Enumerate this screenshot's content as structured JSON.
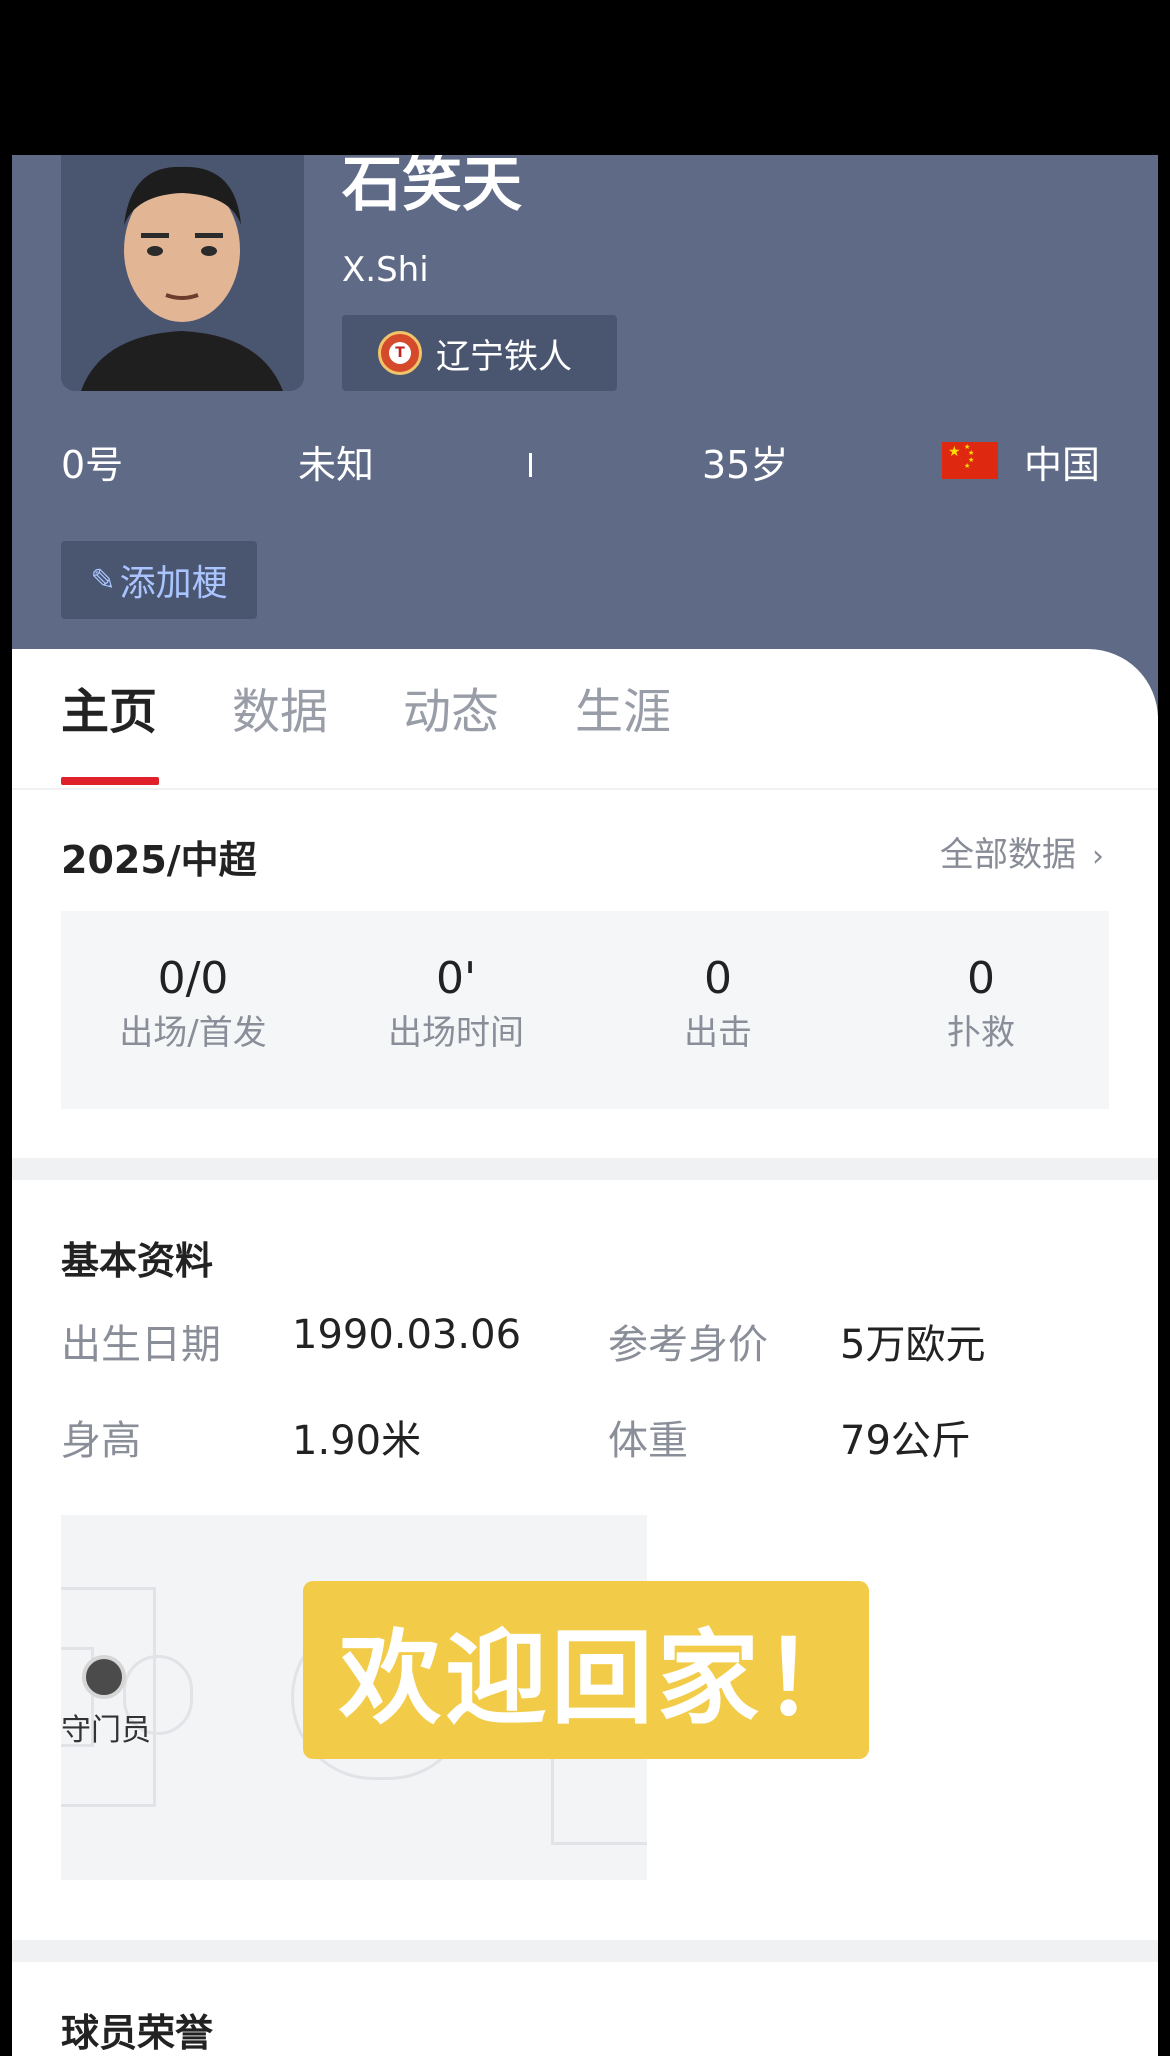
{
  "player": {
    "name": "石笑天",
    "en_name": "X.Shi",
    "team": "辽宁铁人",
    "number": "0号",
    "position": "未知",
    "age": "35岁",
    "nationality": "中国",
    "add_meme_label": "添加梗"
  },
  "tabs": [
    {
      "label": "主页",
      "active": true
    },
    {
      "label": "数据",
      "active": false
    },
    {
      "label": "动态",
      "active": false
    },
    {
      "label": "生涯",
      "active": false
    }
  ],
  "season": {
    "title": "2025/中超",
    "all_data_label": "全部数据",
    "stats": [
      {
        "value": "0/0",
        "label": "出场/首发"
      },
      {
        "value": "0'",
        "label": "出场时间"
      },
      {
        "value": "0",
        "label": "出击"
      },
      {
        "value": "0",
        "label": "扑救"
      }
    ]
  },
  "basic_info": {
    "title": "基本资料",
    "rows": [
      {
        "label": "出生日期",
        "value": "1990.03.06"
      },
      {
        "label": "参考身价",
        "value": "5万欧元"
      },
      {
        "label": "身高",
        "value": "1.90米"
      },
      {
        "label": "体重",
        "value": "79公斤"
      }
    ],
    "pitch_position_label": "守门员"
  },
  "banner_text": "欢迎回家！",
  "honors_title": "球员荣誉",
  "colors": {
    "header_bg": "#5f6a87",
    "accent_red": "#e0202b",
    "banner_yellow": "#f2cc48"
  }
}
